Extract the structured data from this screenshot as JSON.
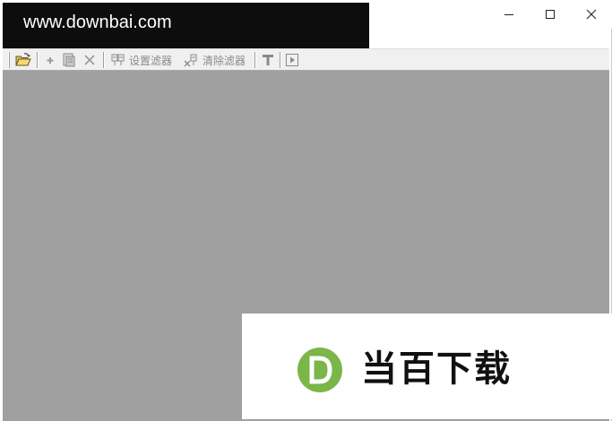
{
  "watermark": {
    "text": "www.downbai.com"
  },
  "window_controls": {
    "minimize": "minimize-icon",
    "maximize": "maximize-icon",
    "close": "close-icon"
  },
  "toolbar": {
    "open_icon": "folder-open-icon",
    "add_icon": "plus-icon",
    "edit_icon": "document-edit-icon",
    "delete_icon": "x-icon",
    "set_filter_label": "设置滤器",
    "clear_filter_label": "清除滤器",
    "text_icon": "text-t-icon",
    "play_icon": "play-box-icon"
  },
  "logo": {
    "text": "当百下载",
    "letter": "D",
    "accent": "#7ab648"
  },
  "colors": {
    "client_bg": "#a0a0a0",
    "toolbar_bg": "#f0f0f0"
  }
}
